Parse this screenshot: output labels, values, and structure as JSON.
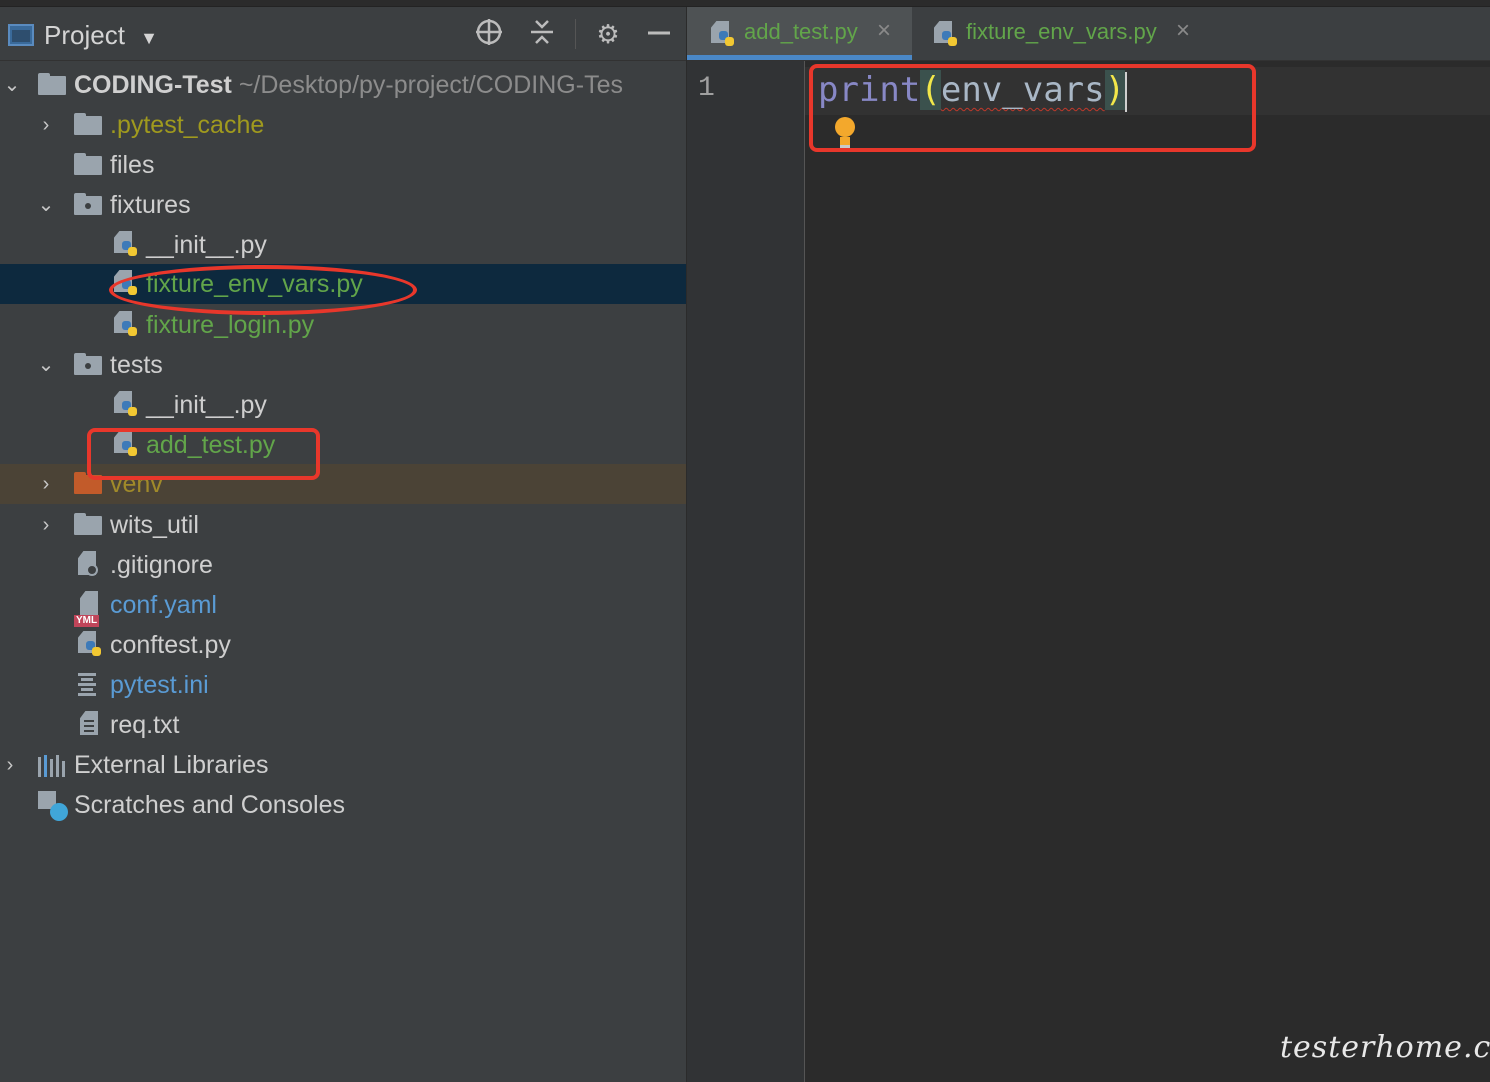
{
  "project_panel": {
    "title": "Project",
    "header_icons": [
      "locate-icon",
      "collapse-all-icon",
      "gear-icon",
      "minimize-icon"
    ]
  },
  "tree": {
    "root_name": "CODING-Test",
    "root_path": "~/Desktop/py-project/CODING-Tes",
    "pytest_cache": ".pytest_cache",
    "files": "files",
    "fixtures": "fixtures",
    "fixtures_init": "__init__.py",
    "fixture_env_vars": "fixture_env_vars.py",
    "fixture_login": "fixture_login.py",
    "tests": "tests",
    "tests_init": "__init__.py",
    "add_test": "add_test.py",
    "venv": "venv",
    "wits_util": "wits_util",
    "gitignore": ".gitignore",
    "conf_yaml": "conf.yaml",
    "conftest": "conftest.py",
    "pytest_ini": "pytest.ini",
    "req_txt": "req.txt",
    "external_libraries": "External Libraries",
    "scratches": "Scratches and Consoles"
  },
  "tabs": [
    {
      "label": "add_test.py",
      "active": true
    },
    {
      "label": "fixture_env_vars.py",
      "active": false
    }
  ],
  "editor": {
    "line_number": "1",
    "code_keyword": "print",
    "code_open": "(",
    "code_ident": "env_vars",
    "code_close": ")"
  },
  "colors": {
    "annotation": "#e8372b",
    "selection": "#0d293e",
    "modified_file": "#62a54a",
    "tab_underline": "#4a88c7"
  },
  "watermark": "testerhome.com"
}
